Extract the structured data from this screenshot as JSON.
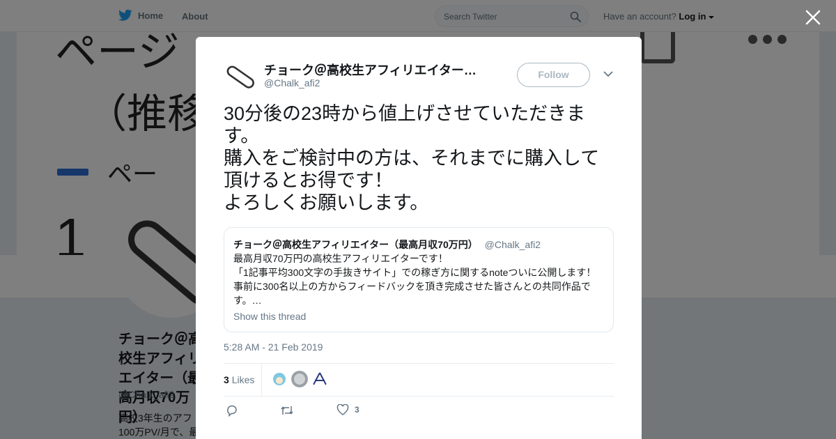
{
  "nav": {
    "home_label": "Home",
    "about_label": "About",
    "search_placeholder": "Search Twitter",
    "account_prompt": "Have an account?",
    "login_label": "Log in"
  },
  "background_profile": {
    "name": "チョーク＠高校生アフィリエイター（最高月収70万円）",
    "name_visible": "チョーク＠高 エイター（ 円）",
    "handle": "@Chalk_afi2",
    "bio_visible": "高校3年生のアフ 100万PV/月で、最",
    "banner_text_1": "ページ",
    "banner_text_2": "（推移",
    "banner_text_3": "ペー",
    "banner_text_4": "1"
  },
  "tweet": {
    "author_name": "チョーク＠高校生アフィリエイター（最高月収70万円）",
    "author_handle": "@Chalk_afi2",
    "follow_label": "Follow",
    "text": "30分後の23時から値上げさせていただきます。\n購入をご検討中の方は、それまでに購入して頂けるとお得です！\nよろしくお願いします。",
    "timestamp": "5:28 AM - 21 Feb 2019",
    "likes_count": "3",
    "likes_label": "Likes",
    "like_action_count": "3"
  },
  "quoted_tweet": {
    "author_name": "チョーク＠高校生アフィリエイター（最高月収70万円）",
    "author_handle": "@Chalk_afi2",
    "text": "最高月収70万円の高校生アフィリエイターです！\n「1記事平均300文字の手抜きサイト」での稼ぎ方に関するnoteついに公開します！\n事前に300名以上の方からフィードバックを頂き完成させた皆さんとの共同作品です。…",
    "show_thread_label": "Show this thread"
  },
  "colors": {
    "brand_blue": "#1da1f2",
    "text_primary": "#14171a",
    "text_secondary": "#657786",
    "overlay": "rgba(0,0,0,0.5)"
  }
}
